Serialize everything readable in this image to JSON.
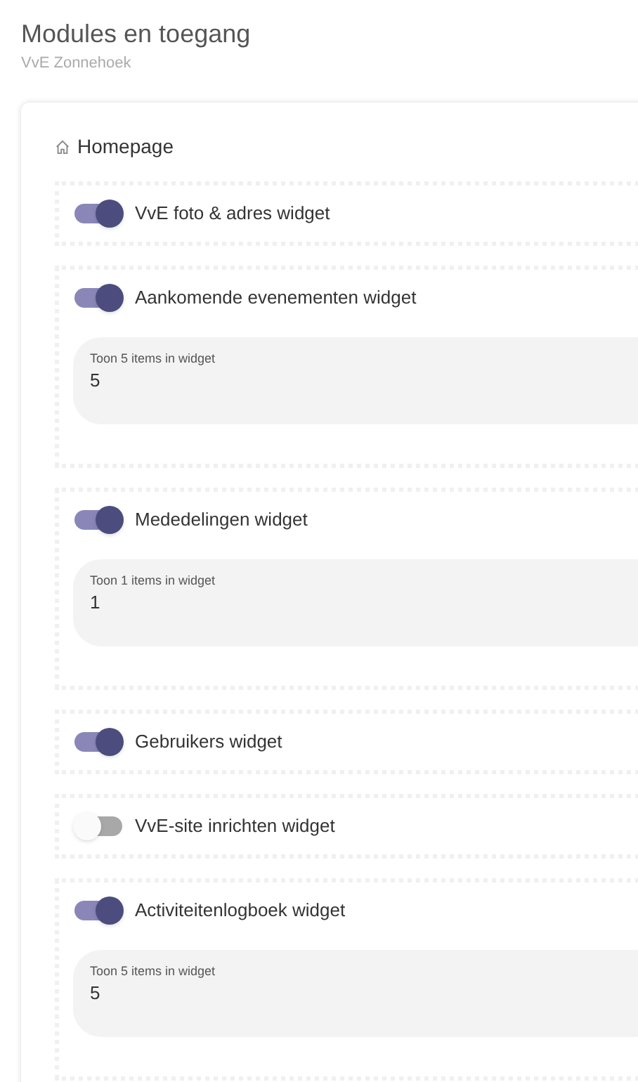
{
  "header": {
    "title": "Modules en toegang",
    "subtitle": "VvE Zonnehoek"
  },
  "section": {
    "title": "Homepage"
  },
  "widgets": [
    {
      "label": "VvE foto & adres widget",
      "on": true
    },
    {
      "label": "Aankomende evenementen widget",
      "on": true,
      "items_field": {
        "label": "Toon 5 items in widget",
        "value": "5"
      }
    },
    {
      "label": "Mededelingen widget",
      "on": true,
      "items_field": {
        "label": "Toon 1 items in widget",
        "value": "1"
      }
    },
    {
      "label": "Gebruikers widget",
      "on": true
    },
    {
      "label": "VvE-site inrichten widget",
      "on": false
    },
    {
      "label": "Activiteitenlogboek widget",
      "on": true,
      "items_field": {
        "label": "Toon 5 items in widget",
        "value": "5"
      }
    }
  ]
}
